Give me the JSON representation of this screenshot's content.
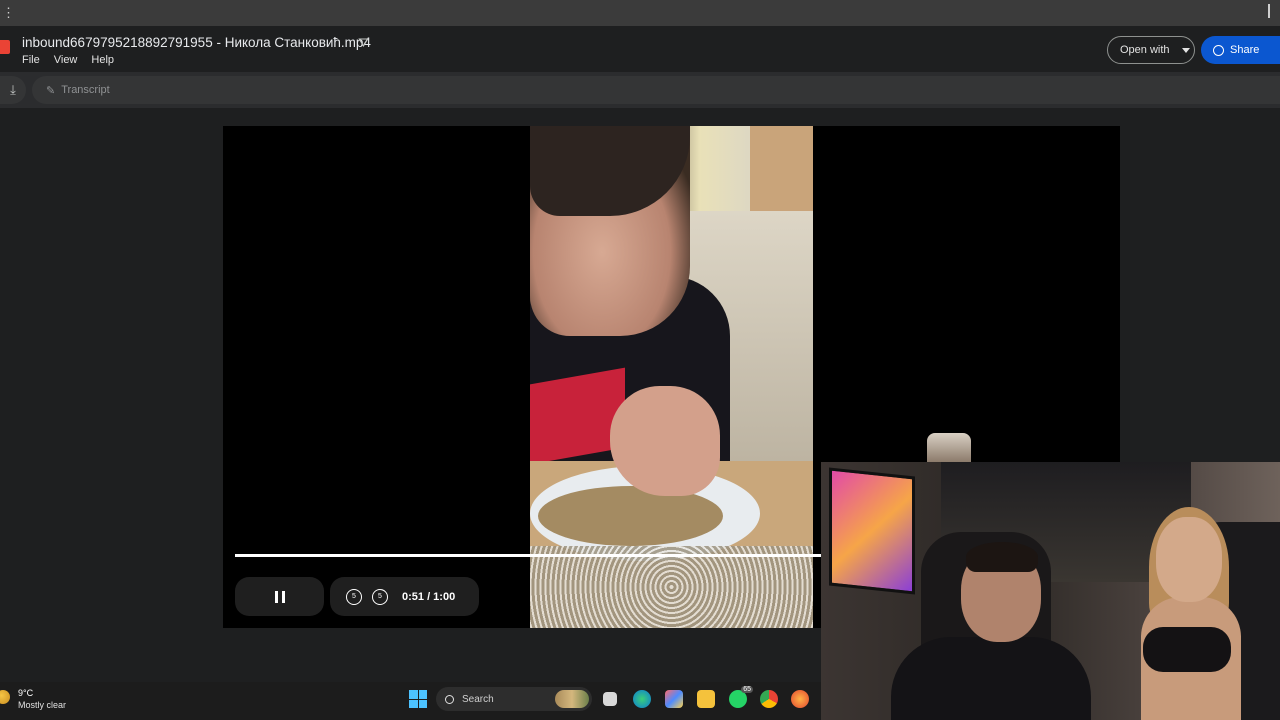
{
  "topbar": {
    "dots": "⋮"
  },
  "header": {
    "file_title": "inbound6679795218892791955 - Никола Станковић.mp4",
    "menu": [
      "File",
      "View",
      "Help"
    ],
    "open_with_label": "Open with",
    "share_label": "Share"
  },
  "toolbar": {
    "transcript_label": "Transcript"
  },
  "player": {
    "current_time": "0:51",
    "duration": "1:00",
    "time_display": "0:51 / 1:00",
    "progress_fraction": 0.85,
    "skip_back_label": "5",
    "skip_forward_label": "5"
  },
  "taskbar": {
    "temperature": "9°C",
    "weather": "Mostly clear",
    "search_placeholder": "Search",
    "whatsapp_badge": "65"
  },
  "colors": {
    "accent": "#0b57d0",
    "background": "#1e1f20",
    "toolbar": "#2b2c2e",
    "file_icon": "#ea4335"
  },
  "icons": [
    "file-video-icon",
    "drive-icon",
    "download-icon",
    "transcript-icon",
    "globe-icon",
    "pause-icon",
    "rewind-icon",
    "forward-icon",
    "windows-icon",
    "search-icon"
  ]
}
